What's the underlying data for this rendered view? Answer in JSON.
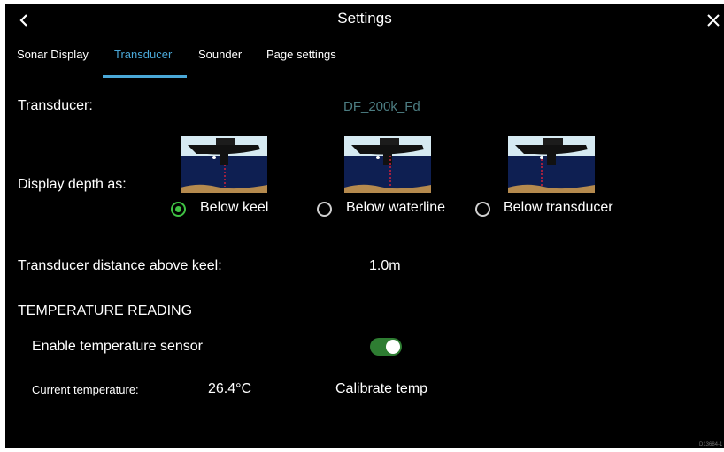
{
  "header": {
    "title": "Settings",
    "back_icon": "chevron-left-icon",
    "close_icon": "close-icon"
  },
  "tabs": [
    {
      "label": "Sonar Display",
      "active": false
    },
    {
      "label": "Transducer",
      "active": true
    },
    {
      "label": "Sounder",
      "active": false
    },
    {
      "label": "Page settings",
      "active": false
    }
  ],
  "transducer": {
    "label": "Transducer:",
    "value": "DF_200k_Fd"
  },
  "display_depth": {
    "label": "Display depth as:",
    "options": [
      {
        "label": "Below keel",
        "selected": true
      },
      {
        "label": "Below waterline",
        "selected": false
      },
      {
        "label": "Below transducer",
        "selected": false
      }
    ]
  },
  "keel_distance": {
    "label": "Transducer distance above keel:",
    "value": "1.0m"
  },
  "temperature": {
    "heading": "TEMPERATURE READING",
    "enable_label": "Enable temperature sensor",
    "enabled": true,
    "current_label": "Current temperature:",
    "current_value": "26.4°C",
    "calibrate_label": "Calibrate temp"
  },
  "corner_code": "D13684-1",
  "colors": {
    "accent": "#4aa8d8",
    "radio_selected": "#3fc143",
    "toggle_on": "#2e7d32",
    "dim_value": "#4c7d82"
  }
}
